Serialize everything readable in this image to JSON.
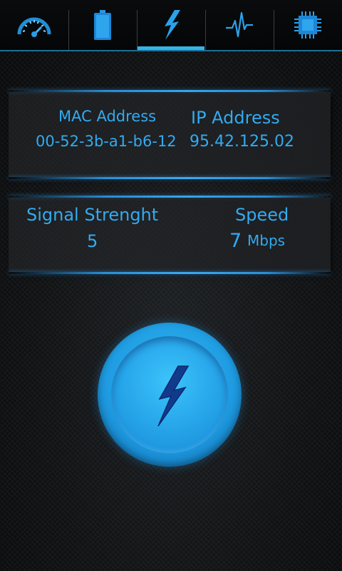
{
  "tabs": [
    {
      "name": "speedometer-icon",
      "active": false
    },
    {
      "name": "battery-icon",
      "active": false
    },
    {
      "name": "lightning-icon",
      "active": true
    },
    {
      "name": "pulse-icon",
      "active": false
    },
    {
      "name": "cpu-chip-icon",
      "active": false
    }
  ],
  "network": {
    "mac_label": "MAC Address",
    "mac_value": "00-52-3b-a1-b6-12",
    "ip_label": "IP Address",
    "ip_value": "95.42.125.02"
  },
  "wifi": {
    "signal_label": "Signal Strenght",
    "signal_value": "5",
    "speed_label": "Speed",
    "speed_value": "7",
    "speed_unit": "Mbps"
  },
  "boost_button": {
    "icon": "lightning-bolt-icon"
  },
  "colors": {
    "accent": "#33aaf0",
    "tab_indicator": "#33b5e5",
    "background": "#0c0d0f"
  }
}
